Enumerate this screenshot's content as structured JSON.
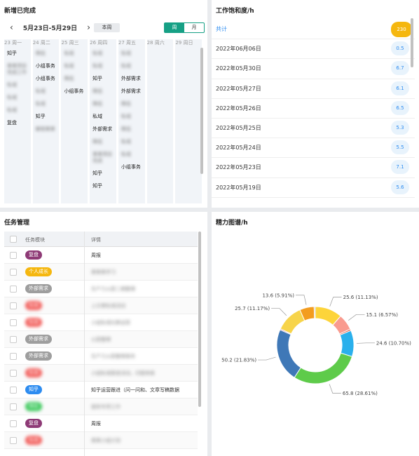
{
  "calendar": {
    "title": "新增已完成",
    "range": "5月23日-5月29日",
    "this_week": "本周",
    "week": "周",
    "month": "月",
    "days": [
      {
        "label": "23 周一",
        "items": [
          {
            "t": "知乎",
            "b": false
          },
          {
            "t": "某某项目完成工作",
            "b": true
          },
          {
            "t": "私域",
            "b": true
          },
          {
            "t": "私域",
            "b": true
          },
          {
            "t": "私域",
            "b": true
          },
          {
            "t": "复盘",
            "b": false
          }
        ]
      },
      {
        "label": "24 周二",
        "items": [
          {
            "t": "降低",
            "b": true
          },
          {
            "t": "小组事务",
            "b": false
          },
          {
            "t": "小组事务",
            "b": false
          },
          {
            "t": "私域",
            "b": true
          },
          {
            "t": "私域",
            "b": true
          },
          {
            "t": "知乎",
            "b": false
          },
          {
            "t": "解锁某某",
            "b": true
          }
        ]
      },
      {
        "label": "25 周三",
        "items": [
          {
            "t": "私域",
            "b": true
          },
          {
            "t": "私域",
            "b": true
          },
          {
            "t": "降低",
            "b": true
          },
          {
            "t": "小组事务",
            "b": false
          }
        ]
      },
      {
        "label": "26 周四",
        "items": [
          {
            "t": "私域",
            "b": true
          },
          {
            "t": "私域",
            "b": true
          },
          {
            "t": "知乎",
            "b": false
          },
          {
            "t": "降低",
            "b": true
          },
          {
            "t": "降低",
            "b": true
          },
          {
            "t": "私域",
            "b": false
          },
          {
            "t": "外部需求",
            "b": false
          },
          {
            "t": "降低",
            "b": true
          },
          {
            "t": "某某项目完成",
            "b": true
          },
          {
            "t": "知乎",
            "b": false
          },
          {
            "t": "知乎",
            "b": false
          }
        ]
      },
      {
        "label": "27 周五",
        "items": [
          {
            "t": "私域",
            "b": true
          },
          {
            "t": "私域",
            "b": true
          },
          {
            "t": "外部需求",
            "b": false
          },
          {
            "t": "外部需求",
            "b": false
          },
          {
            "t": "降低",
            "b": true
          },
          {
            "t": "私域",
            "b": true
          },
          {
            "t": "降低",
            "b": true
          },
          {
            "t": "私域",
            "b": true
          },
          {
            "t": "私域",
            "b": true
          },
          {
            "t": "小组事务",
            "b": false
          }
        ]
      },
      {
        "label": "28 周六",
        "items": []
      },
      {
        "label": "29 周日",
        "items": []
      }
    ]
  },
  "work": {
    "title": "工作饱和度/h",
    "total_label": "共计",
    "total_value": "230",
    "rows": [
      {
        "date": "2022年06月06日",
        "value": "0.5"
      },
      {
        "date": "2022年05月30日",
        "value": "6.7"
      },
      {
        "date": "2022年05月27日",
        "value": "6.1"
      },
      {
        "date": "2022年05月26日",
        "value": "6.5"
      },
      {
        "date": "2022年05月25日",
        "value": "5.3"
      },
      {
        "date": "2022年05月24日",
        "value": "5.5"
      },
      {
        "date": "2022年05月23日",
        "value": "7.1"
      },
      {
        "date": "2022年05月19日",
        "value": "5.6"
      }
    ]
  },
  "tasks": {
    "title": "任务管理",
    "col_module": "任务模块",
    "col_detail": "详情",
    "rows": [
      {
        "tag": "复盘",
        "color": "#8e3a76",
        "tag_blur": false,
        "detail": "周报",
        "detail_blur": false
      },
      {
        "tag": "个人成长",
        "color": "#f5b70f",
        "tag_blur": false,
        "detail": "某某某学习",
        "detail_blur": true
      },
      {
        "tag": "外部需求",
        "color": "#9e9e9e",
        "tag_blur": false,
        "detail": "生产力火箭二期整理",
        "detail_blur": true
      },
      {
        "tag": "私域",
        "color": "#f25f5c",
        "tag_blur": true,
        "detail": "上文某私域活动",
        "detail_blur": true
      },
      {
        "tag": "私域",
        "color": "#f25f5c",
        "tag_blur": true,
        "detail": "小组私域社群运营",
        "detail_blur": true
      },
      {
        "tag": "外部需求",
        "color": "#9e9e9e",
        "tag_blur": false,
        "detail": "火箭整理",
        "detail_blur": true
      },
      {
        "tag": "外部需求",
        "color": "#9e9e9e",
        "tag_blur": false,
        "detail": "生产力火箭整理事务",
        "detail_blur": true
      },
      {
        "tag": "私域",
        "color": "#f25f5c",
        "tag_blur": true,
        "detail": "小组私域渠道活动，问题排查",
        "detail_blur": true
      },
      {
        "tag": "知乎",
        "color": "#2d8cf0",
        "tag_blur": false,
        "detail": "知乎运营跟进（问一问和、文章写稿数据",
        "detail_blur": false
      },
      {
        "tag": "降低",
        "color": "#3bc95b",
        "tag_blur": true,
        "detail": "提效专项工作",
        "detail_blur": true
      },
      {
        "tag": "复盘",
        "color": "#8e3a76",
        "tag_blur": false,
        "detail": "周报",
        "detail_blur": false
      },
      {
        "tag": "私域",
        "color": "#f25f5c",
        "tag_blur": true,
        "detail": "某某小组计划",
        "detail_blur": true
      }
    ]
  },
  "energy": {
    "title": "精力图谱/h"
  },
  "chart_data": {
    "type": "pie",
    "title": "精力图谱/h",
    "donut": true,
    "slices": [
      {
        "value": 25.6,
        "label": "25.6 (11.13%)",
        "color": "#fdd43a"
      },
      {
        "value": 15.1,
        "label": "15.1 (6.57%)",
        "color": "#f99b8f"
      },
      {
        "value": 1.5,
        "label": "",
        "color": "#e6573d"
      },
      {
        "value": 24.6,
        "label": "24.6 (10.70%)",
        "color": "#2ab0ec"
      },
      {
        "value": 65.8,
        "label": "65.8 (28.61%)",
        "color": "#5ecb4a"
      },
      {
        "value": 50.2,
        "label": "50.2 (21.83%)",
        "color": "#3f78b7"
      },
      {
        "value": 1.0,
        "label": "",
        "color": "#a24a86"
      },
      {
        "value": 25.7,
        "label": "25.7 (11.17%)",
        "color": "#f7d44a"
      },
      {
        "value": 13.6,
        "label": "13.6 (5.91%)",
        "color": "#f39c1f"
      },
      {
        "value": 1.1,
        "label": "",
        "color": "#b0b0b0"
      }
    ]
  }
}
